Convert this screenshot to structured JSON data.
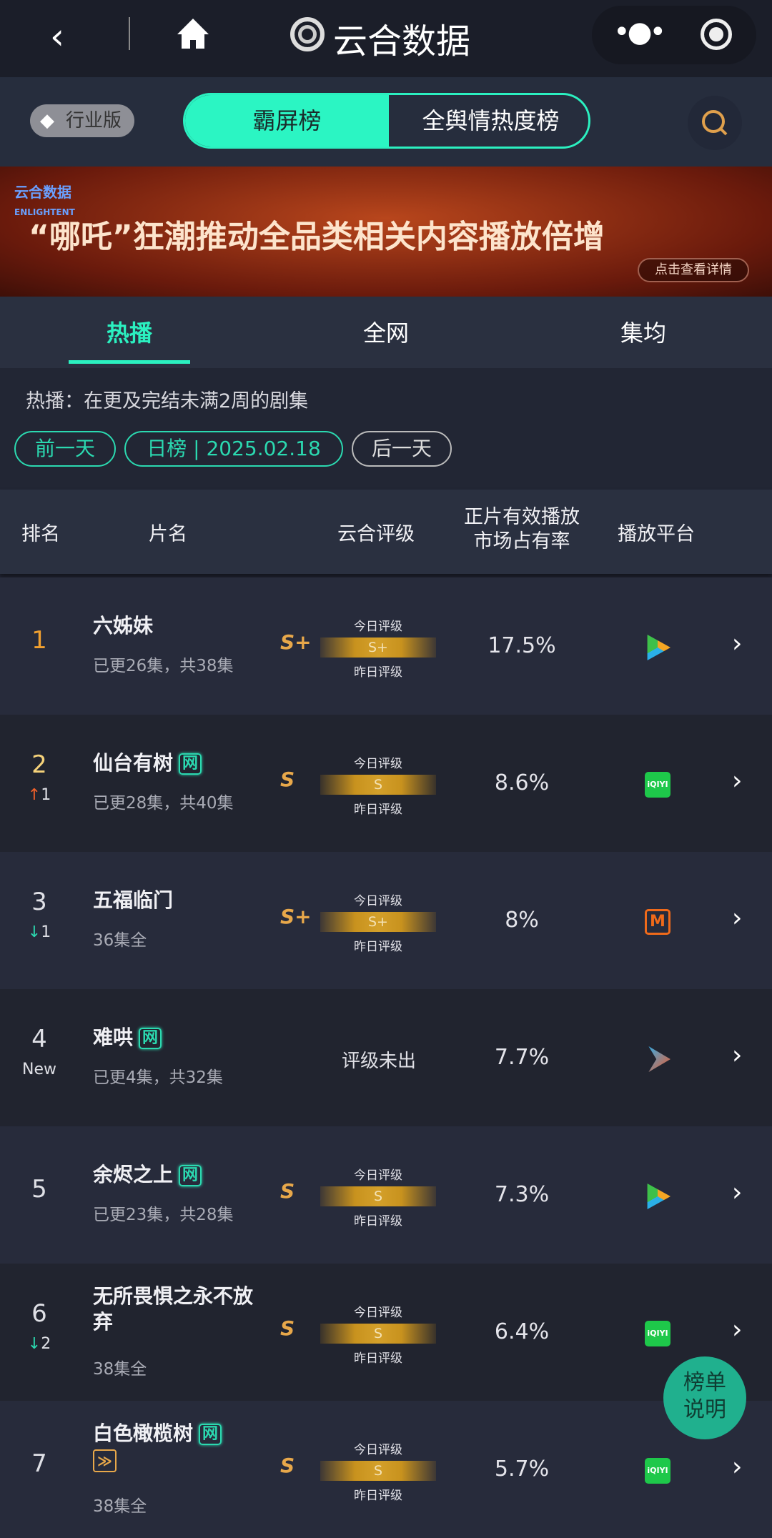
{
  "nav": {
    "title": "云合数据",
    "back_icon": "chevron-left-icon",
    "home_icon": "home-icon",
    "more_icon": "more-icon",
    "target_icon": "record-icon"
  },
  "topbar": {
    "edition": "行业版",
    "tabs": [
      {
        "label": "霸屏榜",
        "active": true
      },
      {
        "label": "全舆情热度榜",
        "active": false
      }
    ],
    "search_icon": "search-icon"
  },
  "banner": {
    "logo_text": "云合数据",
    "logo_sub": "ENLIGHTENT",
    "headline": "“哪吒”狂潮推动全品类相关内容播放倍增",
    "cta": "点击查看详情"
  },
  "subtabs": [
    {
      "label": "热播",
      "active": true
    },
    {
      "label": "全网"
    },
    {
      "label": "集均"
    }
  ],
  "info": {
    "desc": "热播：在更及完结未满2周的剧集",
    "prev": "前一天",
    "date": "日榜 | 2025.02.18",
    "next": "后一天"
  },
  "columns": {
    "rank": "排名",
    "title": "片名",
    "grade": "云合评级",
    "share_l1": "正片有效播放",
    "share_l2": "市场占有率",
    "platform": "播放平台"
  },
  "grade_labels": {
    "today": "今日评级",
    "yesterday": "昨日评级",
    "none": "评级未出"
  },
  "colors": {
    "accent": "#2bd9b0",
    "up": "#f0602a",
    "down": "#2bd9b0",
    "gold": "#e8a84a"
  },
  "rows": [
    {
      "rank": "1",
      "change": "",
      "dir": "",
      "title": "六姊妹",
      "tag": "",
      "sub": "已更26集，共38集",
      "grade": "S+",
      "today": "S+",
      "share": "17.5%",
      "platform": "tencent-video"
    },
    {
      "rank": "2",
      "change": "1",
      "dir": "up",
      "title": "仙台有树",
      "tag": "网",
      "sub": "已更28集，共40集",
      "grade": "S",
      "today": "S",
      "share": "8.6%",
      "platform": "iqiyi"
    },
    {
      "rank": "3",
      "change": "1",
      "dir": "down",
      "title": "五福临门",
      "tag": "",
      "sub": "36集全",
      "grade": "S+",
      "today": "S+",
      "share": "8%",
      "platform": "mango-tv"
    },
    {
      "rank": "4",
      "change": "New",
      "dir": "new",
      "title": "难哄",
      "tag": "网",
      "sub": "已更4集，共32集",
      "grade": "",
      "today": "",
      "share": "7.7%",
      "platform": "youku"
    },
    {
      "rank": "5",
      "change": "",
      "dir": "",
      "title": "余烬之上",
      "tag": "网",
      "sub": "已更23集，共28集",
      "grade": "S",
      "today": "S",
      "share": "7.3%",
      "platform": "tencent-video"
    },
    {
      "rank": "6",
      "change": "2",
      "dir": "down",
      "title": "无所畏惧之永不放弃",
      "tag": "",
      "sub": "38集全",
      "grade": "S",
      "today": "S",
      "share": "6.4%",
      "platform": "iqiyi"
    },
    {
      "rank": "7",
      "change": "",
      "dir": "",
      "title": "白色橄榄树",
      "tag": "网",
      "sub": "38集全",
      "grade": "S",
      "today": "S",
      "share": "5.7%",
      "platform": "iqiyi",
      "extra_icon": "fast-forward-badge-icon"
    }
  ],
  "fab": {
    "line1": "榜单",
    "line2": "说明"
  }
}
